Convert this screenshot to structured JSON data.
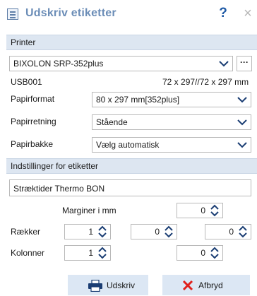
{
  "window": {
    "title": "Udskriv etiketter",
    "help_label": "?",
    "close_label": "×"
  },
  "printer_section": {
    "heading": "Printer",
    "printer_name": "BIXOLON SRP-352plus",
    "more_label": "···",
    "port": "USB001",
    "dimensions": "72 x 297//72 x 297 mm",
    "paper_format_label": "Papirformat",
    "paper_format_value": "80 x 297 mm[352plus]",
    "orientation_label": "Papirretning",
    "orientation_value": "Stående",
    "tray_label": "Papirbakke",
    "tray_value": "Vælg automatisk"
  },
  "label_section": {
    "heading": "Indstillinger for etiketter",
    "template_name": "Stræktider Thermo BON",
    "margins_label": "Marginer i mm",
    "margins_value": "0",
    "rows_label": "Rækker",
    "rows_value_1": "1",
    "rows_value_2": "0",
    "rows_value_3": "0",
    "columns_label": "Kolonner",
    "columns_value_1": "1",
    "columns_value_2": "0"
  },
  "footer": {
    "print_label": "Udskriv",
    "cancel_label": "Afbryd"
  },
  "colors": {
    "title": "#6b8db7",
    "section_header_bg": "#dde6f1",
    "button_bg": "#dce7f4",
    "help_icon": "#1f5aa6",
    "cancel_icon": "#e0201b"
  }
}
